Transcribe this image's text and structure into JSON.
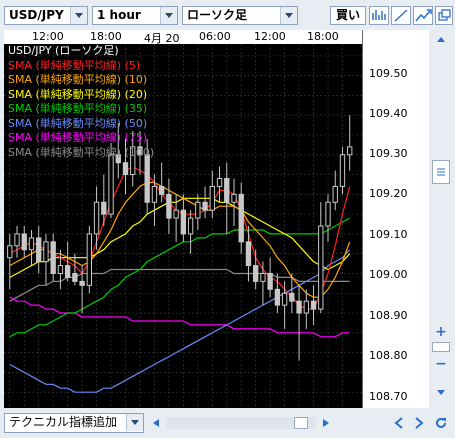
{
  "toolbar": {
    "symbol": "USD/JPY",
    "timeframe": "1 hour",
    "chart_type": "ローソク足",
    "buy_label": "買い"
  },
  "time_axis": [
    "12:00",
    "18:00",
    "4月 20",
    "06:00",
    "12:00",
    "18:00"
  ],
  "price_axis": [
    "109.50",
    "109.40",
    "109.30",
    "109.20",
    "109.10",
    "109.00",
    "108.90",
    "108.80",
    "108.70"
  ],
  "legend": {
    "title": "USD/JPY (ローソク足)",
    "items": [
      {
        "label": "SMA (単純移動平均線) (5)",
        "color": "#ff2020"
      },
      {
        "label": "SMA (単純移動平均線) (10)",
        "color": "#ffa500"
      },
      {
        "label": "SMA (単純移動平均線) (20)",
        "color": "#ffff00"
      },
      {
        "label": "SMA (単純移動平均線) (35)",
        "color": "#00cc00"
      },
      {
        "label": "SMA (単純移動平均線) (50)",
        "color": "#6a8cff"
      },
      {
        "label": "SMA (単純移動平均線) (75)",
        "color": "#ff00ff"
      },
      {
        "label": "SMA (単純移動平均線) (100)",
        "color": "#8a8a8a"
      }
    ]
  },
  "side": {
    "zoom_in": "+",
    "zoom_out": "−"
  },
  "bottom": {
    "add_indicator": "テクニカル指標追加"
  },
  "chart_data": {
    "type": "candlestick",
    "symbol": "USD/JPY",
    "ylim": [
      108.66,
      109.58
    ],
    "candles": [
      [
        109.04,
        109.1,
        108.96,
        109.07
      ],
      [
        109.07,
        109.12,
        109.04,
        109.1
      ],
      [
        109.1,
        109.12,
        109.04,
        109.06
      ],
      [
        109.06,
        109.11,
        109.02,
        109.09
      ],
      [
        109.09,
        109.12,
        109.0,
        109.03
      ],
      [
        109.03,
        109.1,
        108.97,
        109.08
      ],
      [
        109.08,
        109.1,
        108.98,
        109.0
      ],
      [
        109.0,
        109.06,
        108.96,
        109.02
      ],
      [
        109.02,
        109.08,
        108.98,
        108.99
      ],
      [
        109.0,
        109.05,
        108.97,
        108.98
      ],
      [
        108.98,
        109.02,
        108.9,
        108.97
      ],
      [
        108.97,
        109.12,
        108.95,
        109.1
      ],
      [
        109.1,
        109.22,
        109.06,
        109.18
      ],
      [
        109.18,
        109.25,
        109.12,
        109.15
      ],
      [
        109.15,
        109.33,
        109.14,
        109.3
      ],
      [
        109.3,
        109.38,
        109.24,
        109.28
      ],
      [
        109.28,
        109.34,
        109.2,
        109.25
      ],
      [
        109.25,
        109.36,
        109.22,
        109.32
      ],
      [
        109.32,
        109.36,
        109.25,
        109.3
      ],
      [
        109.3,
        109.34,
        109.15,
        109.18
      ],
      [
        109.18,
        109.25,
        109.12,
        109.22
      ],
      [
        109.22,
        109.28,
        109.18,
        109.2
      ],
      [
        109.2,
        109.24,
        109.1,
        109.14
      ],
      [
        109.14,
        109.2,
        109.08,
        109.16
      ],
      [
        109.16,
        109.2,
        109.08,
        109.1
      ],
      [
        109.1,
        109.16,
        109.05,
        109.14
      ],
      [
        109.14,
        109.2,
        109.11,
        109.18
      ],
      [
        109.18,
        109.22,
        109.14,
        109.16
      ],
      [
        109.16,
        109.26,
        109.14,
        109.22
      ],
      [
        109.22,
        109.27,
        109.18,
        109.24
      ],
      [
        109.24,
        109.28,
        109.1,
        109.18
      ],
      [
        109.18,
        109.24,
        109.12,
        109.2
      ],
      [
        109.2,
        109.23,
        109.05,
        109.08
      ],
      [
        109.08,
        109.12,
        108.98,
        109.02
      ],
      [
        109.02,
        109.06,
        108.96,
        108.98
      ],
      [
        108.98,
        109.03,
        108.92,
        109.0
      ],
      [
        109.0,
        109.04,
        108.94,
        108.96
      ],
      [
        108.96,
        109.0,
        108.9,
        108.92
      ],
      [
        108.92,
        108.98,
        108.86,
        108.95
      ],
      [
        108.95,
        109.0,
        108.9,
        108.93
      ],
      [
        108.93,
        108.97,
        108.78,
        108.9
      ],
      [
        108.9,
        108.96,
        108.86,
        108.93
      ],
      [
        108.93,
        108.97,
        108.87,
        108.91
      ],
      [
        108.91,
        109.18,
        108.9,
        109.12
      ],
      [
        109.12,
        109.2,
        109.08,
        109.18
      ],
      [
        109.18,
        109.26,
        109.16,
        109.22
      ],
      [
        109.22,
        109.32,
        109.2,
        109.3
      ],
      [
        109.3,
        109.4,
        109.26,
        109.32
      ]
    ],
    "sma": {
      "5": [
        109.05,
        109.06,
        109.07,
        109.08,
        109.07,
        109.06,
        109.05,
        109.04,
        109.03,
        109.02,
        109.0,
        109.03,
        109.08,
        109.13,
        109.18,
        109.22,
        109.26,
        109.27,
        109.26,
        109.25,
        109.23,
        109.2,
        109.18,
        109.16,
        109.15,
        109.15,
        109.15,
        109.16,
        109.18,
        109.21,
        109.21,
        109.2,
        109.16,
        109.1,
        109.04,
        109.01,
        108.99,
        108.98,
        108.96,
        108.94,
        108.92,
        108.91,
        108.91,
        108.95,
        109.0,
        109.07,
        109.15,
        109.22
      ],
      "10": [
        109.02,
        109.03,
        109.04,
        109.05,
        109.06,
        109.06,
        109.05,
        109.05,
        109.04,
        109.03,
        109.02,
        109.03,
        109.05,
        109.08,
        109.11,
        109.15,
        109.18,
        109.2,
        109.22,
        109.23,
        109.23,
        109.22,
        109.21,
        109.2,
        109.19,
        109.18,
        109.17,
        109.16,
        109.16,
        109.17,
        109.17,
        109.17,
        109.16,
        109.13,
        109.11,
        109.09,
        109.07,
        109.04,
        109.02,
        108.99,
        108.97,
        108.95,
        108.94,
        108.94,
        108.96,
        108.99,
        109.03,
        109.08
      ],
      "20": [
        108.99,
        109.0,
        109.01,
        109.02,
        109.03,
        109.03,
        109.04,
        109.04,
        109.04,
        109.04,
        109.04,
        109.04,
        109.05,
        109.06,
        109.08,
        109.09,
        109.1,
        109.12,
        109.13,
        109.15,
        109.16,
        109.17,
        109.18,
        109.18,
        109.19,
        109.19,
        109.19,
        109.19,
        109.19,
        109.18,
        109.18,
        109.17,
        109.16,
        109.15,
        109.14,
        109.13,
        109.12,
        109.11,
        109.1,
        109.09,
        109.07,
        109.05,
        109.03,
        109.02,
        109.01,
        109.02,
        109.03,
        109.05
      ],
      "35": [
        108.84,
        108.85,
        108.85,
        108.86,
        108.87,
        108.87,
        108.88,
        108.89,
        108.9,
        108.9,
        108.91,
        108.92,
        108.93,
        108.94,
        108.96,
        108.97,
        108.99,
        109.0,
        109.01,
        109.03,
        109.04,
        109.05,
        109.06,
        109.07,
        109.08,
        109.08,
        109.09,
        109.09,
        109.1,
        109.1,
        109.1,
        109.11,
        109.11,
        109.11,
        109.11,
        109.11,
        109.1,
        109.1,
        109.1,
        109.1,
        109.1,
        109.1,
        109.1,
        109.1,
        109.11,
        109.12,
        109.13,
        109.14
      ],
      "50": [
        108.77,
        108.76,
        108.75,
        108.74,
        108.73,
        108.72,
        108.72,
        108.71,
        108.71,
        108.7,
        108.7,
        108.7,
        108.7,
        108.71,
        108.71,
        108.72,
        108.73,
        108.74,
        108.75,
        108.76,
        108.77,
        108.78,
        108.79,
        108.8,
        108.81,
        108.82,
        108.83,
        108.84,
        108.85,
        108.86,
        108.87,
        108.88,
        108.89,
        108.9,
        108.91,
        108.92,
        108.93,
        108.94,
        108.95,
        108.96,
        108.97,
        108.98,
        108.99,
        109.0,
        109.02,
        109.03,
        109.04,
        109.06
      ],
      "75": [
        108.94,
        108.93,
        108.93,
        108.92,
        108.92,
        108.91,
        108.91,
        108.9,
        108.9,
        108.9,
        108.89,
        108.89,
        108.89,
        108.89,
        108.89,
        108.89,
        108.89,
        108.88,
        108.88,
        108.88,
        108.88,
        108.88,
        108.88,
        108.88,
        108.88,
        108.87,
        108.87,
        108.87,
        108.87,
        108.87,
        108.87,
        108.86,
        108.86,
        108.86,
        108.86,
        108.86,
        108.86,
        108.85,
        108.85,
        108.85,
        108.85,
        108.85,
        108.85,
        108.84,
        108.84,
        108.84,
        108.85,
        108.85
      ],
      "100": [
        108.93,
        108.94,
        108.95,
        108.96,
        108.97,
        108.97,
        108.98,
        108.98,
        108.99,
        108.99,
        109.0,
        109.0,
        109.0,
        109.0,
        109.01,
        109.01,
        109.01,
        109.01,
        109.01,
        109.01,
        109.01,
        109.01,
        109.01,
        109.01,
        109.01,
        109.01,
        109.01,
        109.01,
        109.01,
        109.01,
        109.01,
        109.0,
        109.0,
        109.0,
        109.0,
        109.0,
        109.0,
        108.99,
        108.99,
        108.99,
        108.98,
        108.98,
        108.98,
        108.98,
        108.98,
        108.98,
        108.98,
        108.98
      ]
    }
  }
}
